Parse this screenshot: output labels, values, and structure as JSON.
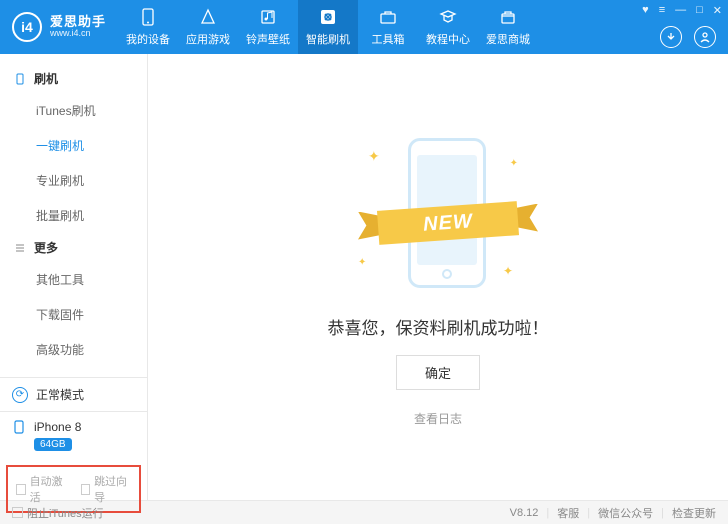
{
  "header": {
    "logo_text": "i4",
    "logo_title": "爱思助手",
    "logo_url": "www.i4.cn",
    "nav": [
      {
        "label": "我的设备"
      },
      {
        "label": "应用游戏"
      },
      {
        "label": "铃声壁纸"
      },
      {
        "label": "智能刷机"
      },
      {
        "label": "工具箱"
      },
      {
        "label": "教程中心"
      },
      {
        "label": "爱思商城"
      }
    ],
    "active_nav_index": 3
  },
  "sidebar": {
    "groups": [
      {
        "title": "刷机",
        "items": [
          "iTunes刷机",
          "一键刷机",
          "专业刷机",
          "批量刷机"
        ],
        "selected_index": 1
      },
      {
        "title": "更多",
        "items": [
          "其他工具",
          "下载固件",
          "高级功能"
        ],
        "selected_index": -1
      }
    ],
    "status": {
      "label": "正常模式"
    },
    "device": {
      "name": "iPhone 8",
      "storage": "64GB"
    },
    "options": {
      "auto_activate": "自动激活",
      "skip_wizard": "跳过向导"
    }
  },
  "main": {
    "ribbon_text": "NEW",
    "success_title": "恭喜您，保资料刷机成功啦！",
    "confirm_label": "确定",
    "view_log_label": "查看日志"
  },
  "statusbar": {
    "block_itunes": "阻止iTunes运行",
    "version": "V8.12",
    "links": [
      "客服",
      "微信公众号",
      "检查更新"
    ]
  }
}
